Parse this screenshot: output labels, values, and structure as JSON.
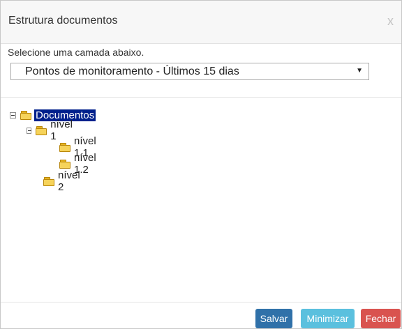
{
  "dialog": {
    "title": "Estrutura documentos",
    "close_glyph": "x"
  },
  "layer_select": {
    "label": "Selecione uma camada abaixo.",
    "value": "Pontos de monitoramento - Últimos 15 dias",
    "arrow": "▼"
  },
  "tree": {
    "root": "Documentos",
    "nivel1": "nível 1",
    "nivel1_1": "nível 1.1",
    "nivel1_2": "nível 1.2",
    "nivel2": "nível 2"
  },
  "footer": {
    "save_label": "Salvar",
    "minimize_label": "Minimizar",
    "close_label": "Fechar"
  },
  "colors": {
    "save": "#3071a9",
    "minimize": "#5bc0de",
    "close": "#d9534f",
    "selected_node": "#00208c"
  }
}
